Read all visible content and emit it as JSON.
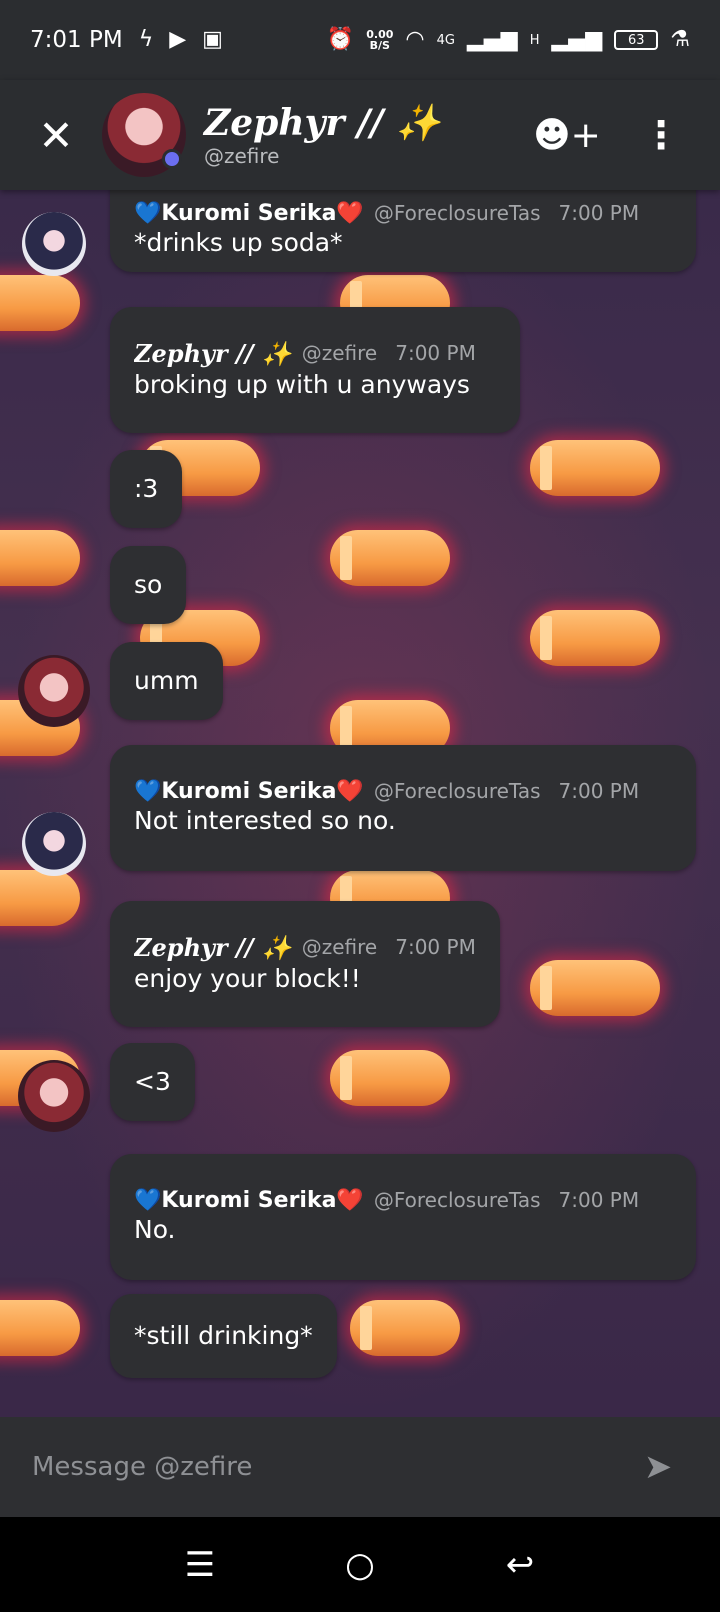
{
  "status_bar": {
    "time": "7:01 PM",
    "speed_value": "0.00",
    "speed_unit": "B/S",
    "network_4g": "4G",
    "network_h": "H",
    "battery": "63"
  },
  "header": {
    "name": "Zephyr // ✨",
    "handle": "@zefire"
  },
  "messages": [
    {
      "kind": "continue_top",
      "author": "💙Kuromi Serika❤️",
      "handle": "@ForeclosureTas",
      "time": "7:00 PM",
      "text": "*drinks up soda*"
    },
    {
      "kind": "group",
      "author": "Zephyr // ✨",
      "handle": "@zefire",
      "time": "7:00 PM",
      "text": "broking up with u anyways"
    },
    {
      "kind": "plain",
      "text": ":3"
    },
    {
      "kind": "plain",
      "text": "so"
    },
    {
      "kind": "plain",
      "text": "umm"
    },
    {
      "kind": "group",
      "author": "💙Kuromi Serika❤️",
      "handle": "@ForeclosureTas",
      "time": "7:00 PM",
      "text": "Not interested so no."
    },
    {
      "kind": "group",
      "author": "Zephyr // ✨",
      "handle": "@zefire",
      "time": "7:00 PM",
      "text": "enjoy your block!!"
    },
    {
      "kind": "plain",
      "text": "<3"
    },
    {
      "kind": "group",
      "author": "💙Kuromi Serika❤️",
      "handle": "@ForeclosureTas",
      "time": "7:00 PM",
      "text": "No."
    },
    {
      "kind": "plain",
      "text": "*still drinking*"
    }
  ],
  "composer": {
    "placeholder": "Message @zefire"
  },
  "icons": {
    "close": "close-icon",
    "add_friend": "add-friend-icon",
    "more": "more-vertical-icon",
    "send": "send-icon",
    "nav_menu": "menu-icon",
    "nav_home": "home-icon",
    "nav_back": "back-icon"
  }
}
